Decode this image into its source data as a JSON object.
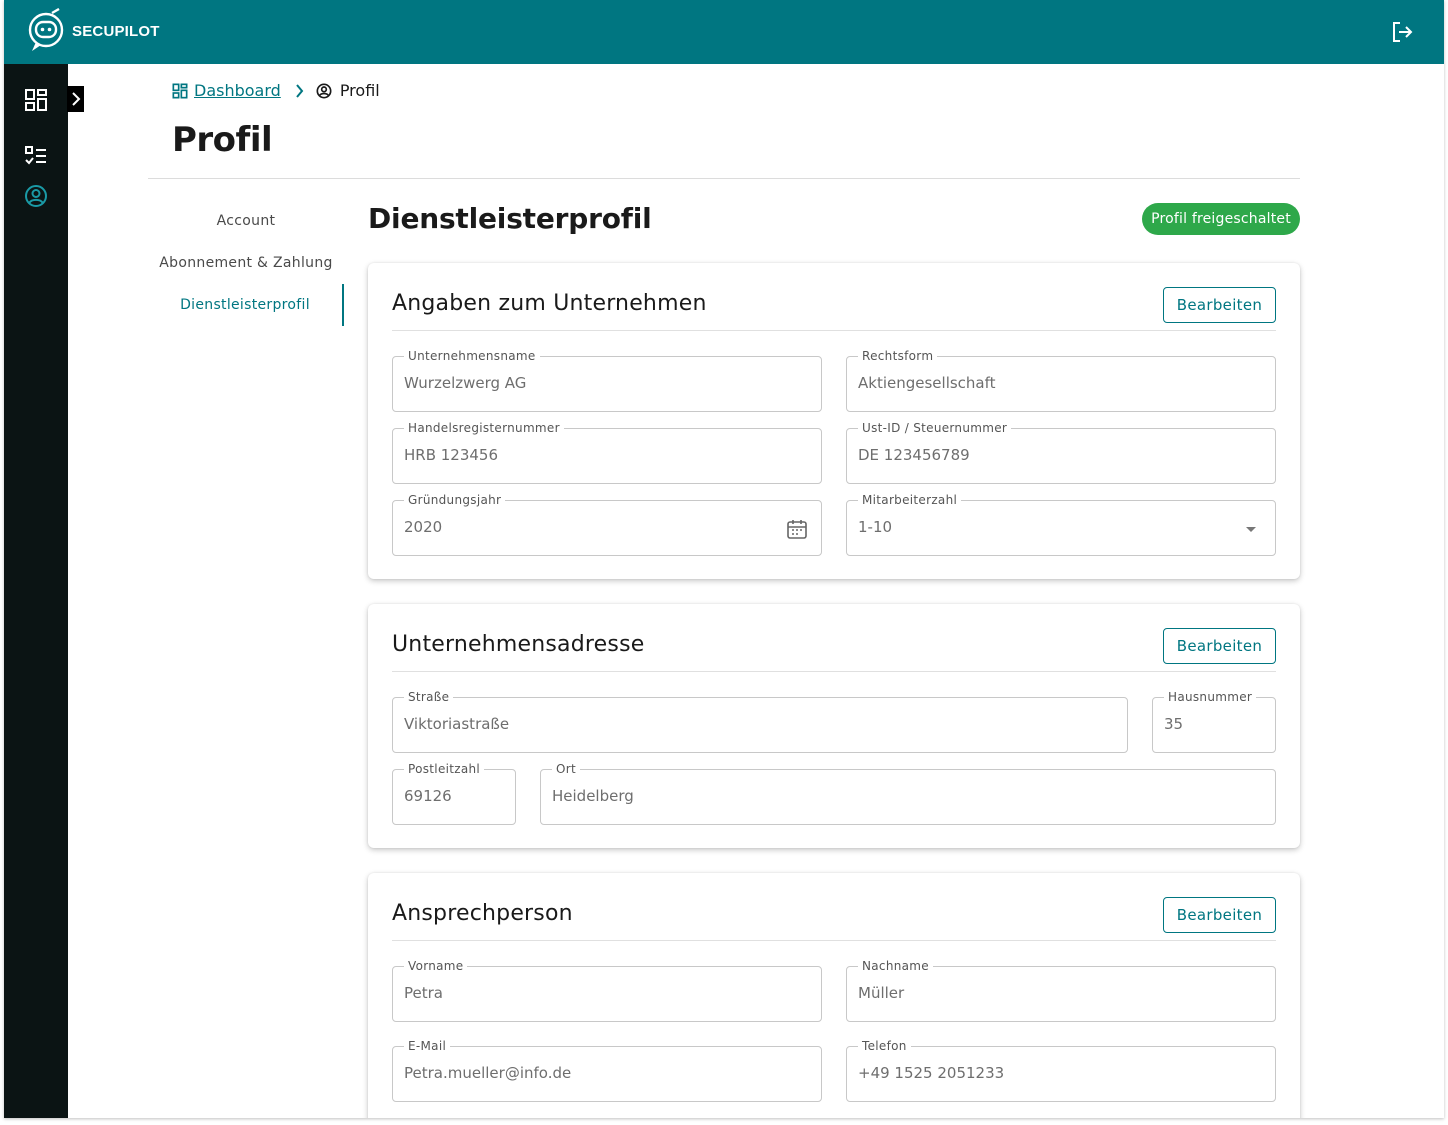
{
  "app": {
    "brand": "SECUPILOT"
  },
  "breadcrumb": {
    "dashboard": "Dashboard",
    "current": "Profil"
  },
  "page": {
    "title": "Profil"
  },
  "subnav": [
    {
      "label": "Account"
    },
    {
      "label": "Abonnement & Zahlung"
    },
    {
      "label": "Dienstleisterprofil"
    }
  ],
  "section": {
    "title": "Dienstleisterprofil",
    "status": "Profil freigeschaltet"
  },
  "edit_label": "Bearbeiten",
  "company": {
    "title": "Angaben zum Unternehmen",
    "fields": {
      "name": {
        "label": "Unternehmensname",
        "value": "Wurzelzwerg AG"
      },
      "legal_form": {
        "label": "Rechtsform",
        "value": "Aktiengesellschaft"
      },
      "register_number": {
        "label": "Handelsregisternummer",
        "value": "HRB 123456"
      },
      "tax_id": {
        "label": "Ust-ID / Steuernummer",
        "value": "DE 123456789"
      },
      "founding_year": {
        "label": "Gründungsjahr",
        "value": "2020"
      },
      "employees": {
        "label": "Mitarbeiterzahl",
        "value": "1-10"
      }
    }
  },
  "address": {
    "title": "Unternehmensadresse",
    "fields": {
      "street": {
        "label": "Straße",
        "value": "Viktoriastraße"
      },
      "house_number": {
        "label": "Hausnummer",
        "value": "35"
      },
      "postal_code": {
        "label": "Postleitzahl",
        "value": "69126"
      },
      "city": {
        "label": "Ort",
        "value": "Heidelberg"
      }
    }
  },
  "contact": {
    "title": "Ansprechperson",
    "fields": {
      "first_name": {
        "label": "Vorname",
        "value": "Petra"
      },
      "last_name": {
        "label": "Nachname",
        "value": "Müller"
      },
      "email": {
        "label": "E-Mail",
        "value": "Petra.mueller@info.de"
      },
      "phone": {
        "label": "Telefon",
        "value": "+49 1525 2051233"
      }
    }
  },
  "colors": {
    "primary": "#007681",
    "rail": "#0b1414",
    "success": "#2ea84a"
  },
  "icons": [
    "secupilot-logo-icon",
    "logout-icon",
    "dashboard-icon",
    "checklist-icon",
    "profile-icon",
    "chevron-right-icon",
    "calendar-icon",
    "dropdown-arrow-icon"
  ]
}
